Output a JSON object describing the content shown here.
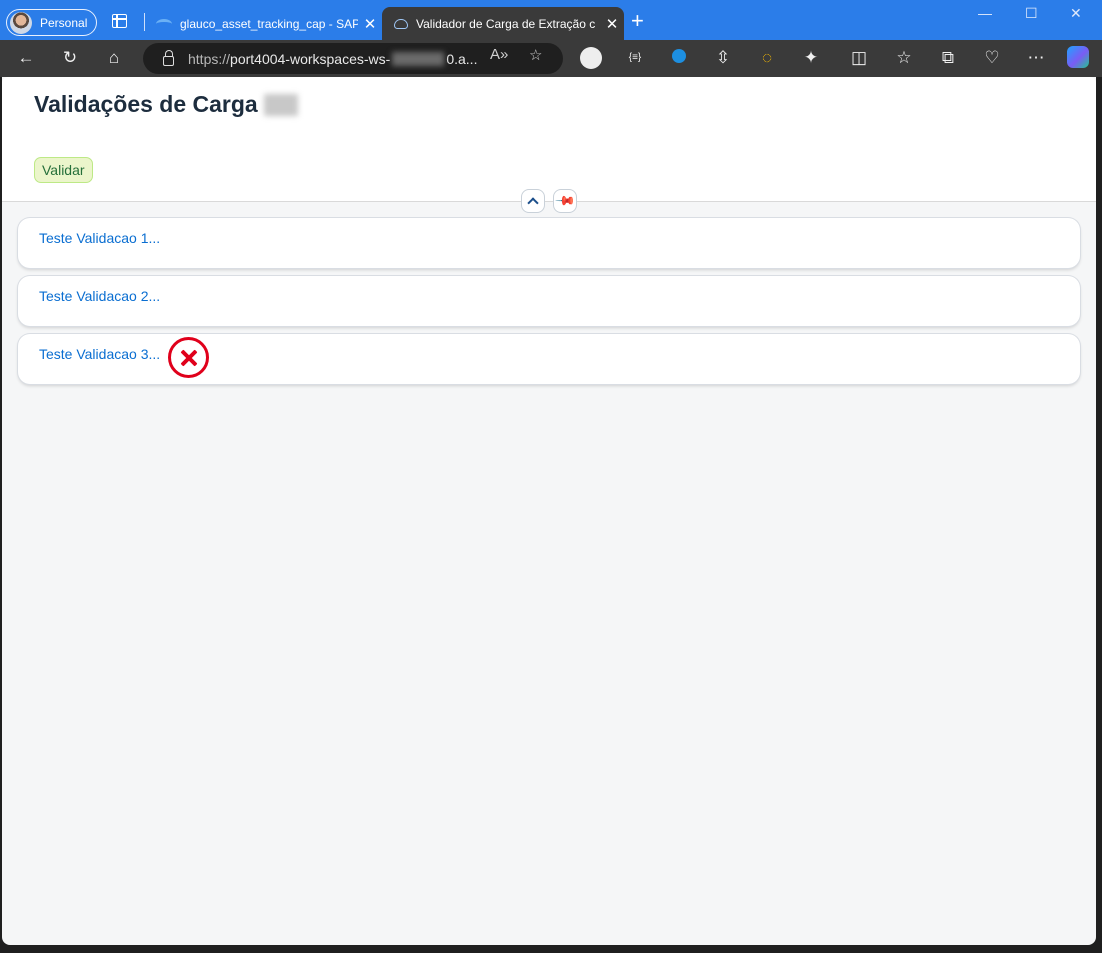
{
  "browser": {
    "profile_label": "Personal",
    "tabs": [
      {
        "label": "glauco_asset_tracking_cap - SAP"
      },
      {
        "label": "Validador de Carga de Extração c"
      }
    ],
    "new_tab_label": "+",
    "address": {
      "url_prefix": "https://",
      "url_host_start": "port4004-workspaces-ws-",
      "url_host_end": "0.a..."
    }
  },
  "page": {
    "title": "Validações de Carga",
    "validate_button_label": "Validar",
    "items": [
      {
        "label": "Teste Validacao 1..."
      },
      {
        "label": "Teste Validacao 2..."
      },
      {
        "label": "Teste Validacao 3..."
      }
    ]
  },
  "colors": {
    "accent": "#0a6ed1",
    "tab_strip": "#2b7de9",
    "error_mark": "#e0001b",
    "validate_bg": "#ebf5cb"
  }
}
